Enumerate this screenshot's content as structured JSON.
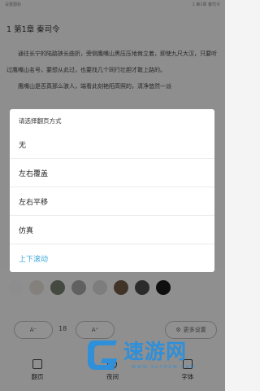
{
  "status_bar": {
    "left": "设置图标",
    "right": "1 第1章 秦司令"
  },
  "reader": {
    "chapter_title": "1 第1章 秦司令",
    "paragraphs": [
      "通往长宁的陆路狭长曲折，旁侧鹰嘴山黑压压地耸立着，即使九尺大汉，只要听过鹰嘴山名号，要想从此过，也要找几个同行壮胆才敢上路的。",
      "鹰嘴山是否真那么骇人，端看此刻艳阳高照的，清净悠然一派"
    ]
  },
  "panel": {
    "swatch_colors": [
      "#f3f3f3",
      "#e4dfd8",
      "#76806f",
      "#a6a6a6",
      "#d8d8d8",
      "#6e5b48",
      "#4a4a4a",
      "#1b1b1b"
    ],
    "font_decrease_label": "A⁻",
    "font_size": "18",
    "font_increase_label": "A⁺",
    "more_settings_label": "更多设置",
    "nav": [
      {
        "label": "翻页",
        "icon": "book-icon"
      },
      {
        "label": "夜间",
        "icon": "moon-icon"
      },
      {
        "label": "字体",
        "icon": "font-icon"
      }
    ]
  },
  "dialog": {
    "title": "请选择翻页方式",
    "options": [
      {
        "label": "无",
        "selected": false
      },
      {
        "label": "左右覆盖",
        "selected": false
      },
      {
        "label": "左右平移",
        "selected": false
      },
      {
        "label": "仿真",
        "selected": false
      },
      {
        "label": "上下滚动",
        "selected": true
      }
    ],
    "selected_color": "#3aa7d8"
  },
  "watermark": {
    "text": "速游网",
    "url": "WWW.SUYOUW.COM"
  }
}
